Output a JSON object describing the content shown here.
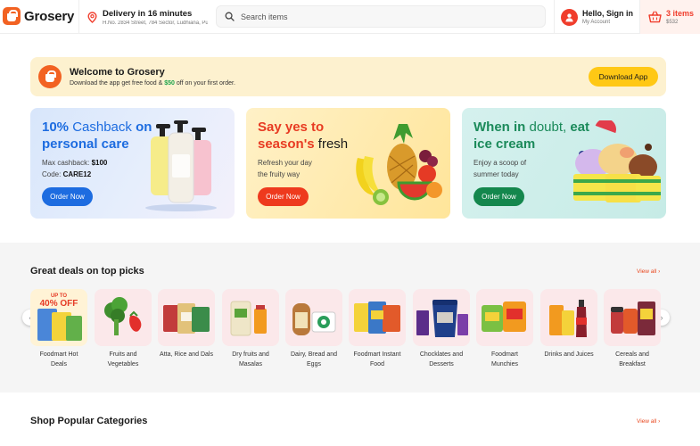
{
  "brand": {
    "name": "Grosery",
    "accent": "#f26222"
  },
  "header": {
    "delivery_title": "Delivery in 16 minutes",
    "delivery_address": "H.No. 2834 Street, 784 Sector, Ludhiana, Punjab",
    "search_placeholder": "Search items",
    "account_title": "Hello, Sign in",
    "account_sub": "My Account",
    "cart_count": "3 items",
    "cart_total": "$532"
  },
  "welcome": {
    "title": "Welcome to Grosery",
    "sub_prefix": "Download the app get free food & ",
    "sub_highlight": "$50",
    "sub_suffix": " off on your first order.",
    "button": "Download App"
  },
  "promos": [
    {
      "head_strong_1": "10%",
      "head_norm_1": " Cashback ",
      "head_strong_2": "on personal care",
      "desc_label_1": "Max cashback: ",
      "desc_value_1": "$100",
      "desc_label_2": "Code: ",
      "desc_value_2": "CARE12",
      "button": "Order Now",
      "color": "#1d6ce0"
    },
    {
      "head_strong_1": "Say yes to season's",
      "head_norm_1": " fresh",
      "desc_line_1": "Refresh your day",
      "desc_line_2": "the fruity way",
      "button": "Order Now",
      "color": "#ee3a1e"
    },
    {
      "head_strong_1": "When in",
      "head_norm_1": " doubt,",
      "head_strong_2": "eat ice cream",
      "desc_line_1": "Enjoy a scoop of",
      "desc_line_2": "summer today",
      "button": "Order Now",
      "color": "#14874d"
    }
  ],
  "deals": {
    "title": "Great deals on top picks",
    "view_all": "View all ›",
    "badge_line_1": "UP TO",
    "badge_line_2": "40% OFF",
    "items": [
      {
        "label": "Foodmart Hot Deals",
        "icon": "hot-deals-icon"
      },
      {
        "label": "Fruits and Vegetables",
        "icon": "vegetables-icon"
      },
      {
        "label": "Atta, Rice and Dals",
        "icon": "rice-bag-icon"
      },
      {
        "label": "Dry fruits and Masalas",
        "icon": "dry-fruits-icon"
      },
      {
        "label": "Dairy, Bread and Eggs",
        "icon": "bread-icon"
      },
      {
        "label": "Foodmart Instant Food",
        "icon": "instant-food-icon"
      },
      {
        "label": "Chocklates and Desserts",
        "icon": "chocolate-icon"
      },
      {
        "label": "Foodmart Munchies",
        "icon": "chips-icon"
      },
      {
        "label": "Drinks and Juices",
        "icon": "drinks-icon"
      },
      {
        "label": "Cereals and Breakfast",
        "icon": "cereal-icon"
      }
    ]
  },
  "popular": {
    "title": "Shop Popular Categories",
    "view_all": "View all ›"
  }
}
